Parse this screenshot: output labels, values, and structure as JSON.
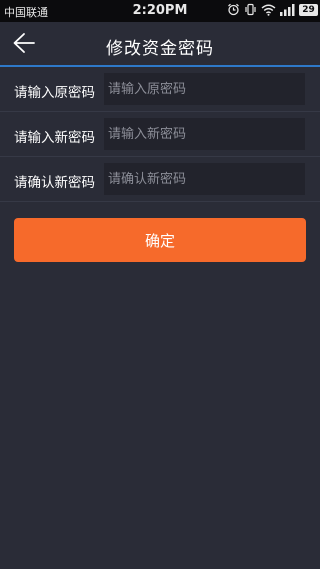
{
  "status_bar": {
    "carrier": "中国联通",
    "time": "2:20PM",
    "battery": "29",
    "icons": [
      "alarm-icon",
      "vibrate-icon",
      "wifi-icon",
      "signal-icon",
      "battery-icon"
    ]
  },
  "header": {
    "back_icon": "back-arrow-icon",
    "title": "修改资金密码",
    "accent_color": "#2e79c9"
  },
  "form": {
    "fields": [
      {
        "label": "请输入原密码",
        "placeholder": "请输入原密码",
        "value": ""
      },
      {
        "label": "请输入新密码",
        "placeholder": "请输入新密码",
        "value": ""
      },
      {
        "label": "请确认新密码",
        "placeholder": "请确认新密码",
        "value": ""
      }
    ]
  },
  "actions": {
    "confirm_label": "确定",
    "confirm_color": "#f66a2b"
  }
}
